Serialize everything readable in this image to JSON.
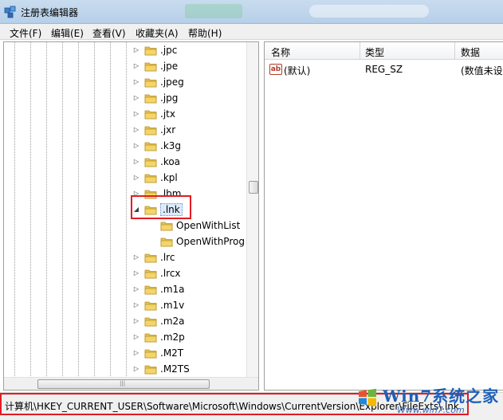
{
  "window": {
    "title": "注册表编辑器"
  },
  "menu": [
    {
      "label": "文件(F)"
    },
    {
      "label": "编辑(E)"
    },
    {
      "label": "查看(V)"
    },
    {
      "label": "收藏夹(A)"
    },
    {
      "label": "帮助(H)"
    }
  ],
  "tree": {
    "items": [
      {
        "label": ".jpc",
        "level": 0,
        "expander": "collapsed"
      },
      {
        "label": ".jpe",
        "level": 0,
        "expander": "collapsed"
      },
      {
        "label": ".jpeg",
        "level": 0,
        "expander": "collapsed"
      },
      {
        "label": ".jpg",
        "level": 0,
        "expander": "collapsed"
      },
      {
        "label": ".jtx",
        "level": 0,
        "expander": "collapsed"
      },
      {
        "label": ".jxr",
        "level": 0,
        "expander": "collapsed"
      },
      {
        "label": ".k3g",
        "level": 0,
        "expander": "collapsed"
      },
      {
        "label": ".koa",
        "level": 0,
        "expander": "collapsed"
      },
      {
        "label": ".kpl",
        "level": 0,
        "expander": "collapsed"
      },
      {
        "label": ".lbm",
        "level": 0,
        "expander": "collapsed"
      },
      {
        "label": ".lnk",
        "level": 0,
        "expander": "expanded",
        "selected": true
      },
      {
        "label": "OpenWithList",
        "level": 1,
        "expander": "none"
      },
      {
        "label": "OpenWithProg",
        "level": 1,
        "expander": "none"
      },
      {
        "label": ".lrc",
        "level": 0,
        "expander": "collapsed"
      },
      {
        "label": ".lrcx",
        "level": 0,
        "expander": "collapsed"
      },
      {
        "label": ".m1a",
        "level": 0,
        "expander": "collapsed"
      },
      {
        "label": ".m1v",
        "level": 0,
        "expander": "collapsed"
      },
      {
        "label": ".m2a",
        "level": 0,
        "expander": "collapsed"
      },
      {
        "label": ".m2p",
        "level": 0,
        "expander": "collapsed"
      },
      {
        "label": ".M2T",
        "level": 0,
        "expander": "collapsed"
      },
      {
        "label": ".M2TS",
        "level": 0,
        "expander": "collapsed"
      }
    ]
  },
  "list": {
    "columns": [
      "名称",
      "类型",
      "数据"
    ],
    "rows": [
      {
        "name": "(默认)",
        "type": "REG_SZ",
        "data": "(数值未设",
        "icon": "string-value-icon"
      }
    ]
  },
  "status": {
    "path": "计算机\\HKEY_CURRENT_USER\\Software\\Microsoft\\Windows\\CurrentVersion\\Explorer\\FileExts\\.lnk"
  },
  "watermark": {
    "text": "Win7系统之家",
    "sub": "Www.win7.com"
  },
  "colors": {
    "highlight": "#e31b23",
    "folder": "#e8c24a",
    "selection": "#dcebfc"
  }
}
